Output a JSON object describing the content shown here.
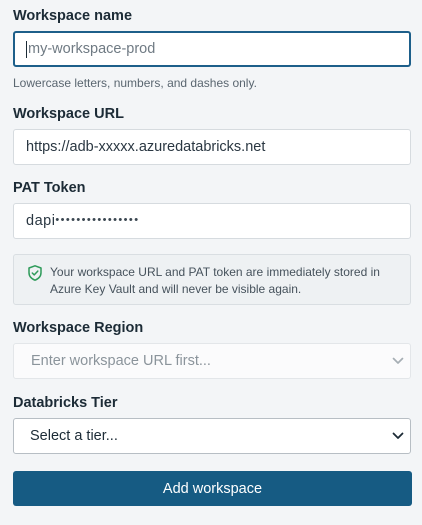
{
  "workspace_name": {
    "label": "Workspace name",
    "value": "my-workspace-prod",
    "hint": "Lowercase letters, numbers, and dashes only."
  },
  "workspace_url": {
    "label": "Workspace URL",
    "value": "https://adb-xxxxx.azuredatabricks.net"
  },
  "pat_token": {
    "label": "PAT Token",
    "prefix": "dapi",
    "masked": "••••••••••••••••"
  },
  "notice": {
    "text": "Your workspace URL and PAT token are immediately stored in Azure Key Vault and will never be visible again.",
    "icon": "shield-check-icon"
  },
  "workspace_region": {
    "label": "Workspace Region",
    "placeholder": "Enter workspace URL first..."
  },
  "databricks_tier": {
    "label": "Databricks Tier",
    "selected": "Select a tier..."
  },
  "submit": {
    "label": "Add workspace"
  },
  "colors": {
    "primary": "#165b83",
    "focus_border": "#1d5f8a",
    "shield": "#2e9b5a",
    "background": "#f3f5f7"
  }
}
